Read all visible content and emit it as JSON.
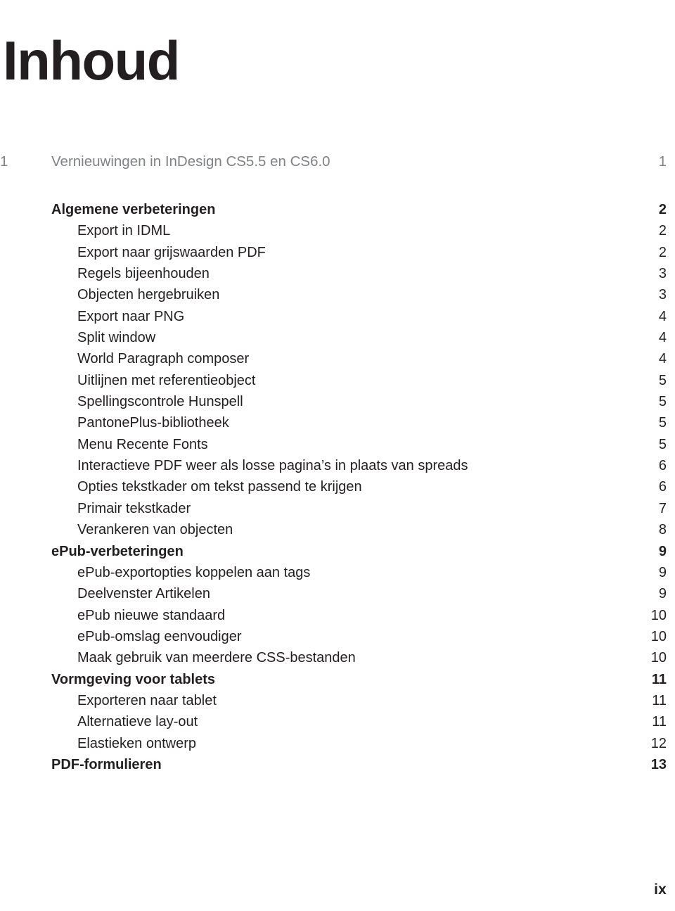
{
  "document": {
    "title": "Inhoud",
    "folio": "ix",
    "text_color": "#231f20",
    "chapter_color": "#808285",
    "background": "#ffffff"
  },
  "chapter": {
    "number": "1",
    "title": "Vernieuwingen in InDesign CS5.5 en CS6.0",
    "page": "1"
  },
  "entries": [
    {
      "level": 1,
      "label": "Algemene verbeteringen",
      "page": "2"
    },
    {
      "level": 2,
      "label": "Export in IDML",
      "page": "2"
    },
    {
      "level": 2,
      "label": "Export naar grijswaarden PDF",
      "page": "2"
    },
    {
      "level": 2,
      "label": "Regels bijeenhouden",
      "page": "3"
    },
    {
      "level": 2,
      "label": "Objecten hergebruiken",
      "page": "3"
    },
    {
      "level": 2,
      "label": "Export naar PNG",
      "page": "4"
    },
    {
      "level": 2,
      "label": "Split window",
      "page": "4"
    },
    {
      "level": 2,
      "label": "World Paragraph composer",
      "page": "4"
    },
    {
      "level": 2,
      "label": "Uitlijnen met referentieobject",
      "page": "5"
    },
    {
      "level": 2,
      "label": "Spellingscontrole Hunspell",
      "page": "5"
    },
    {
      "level": 2,
      "label": "PantonePlus-bibliotheek",
      "page": "5"
    },
    {
      "level": 2,
      "label": "Menu Recente Fonts",
      "page": "5"
    },
    {
      "level": 2,
      "label": "Interactieve PDF weer als losse pagina’s in plaats van spreads",
      "page": "6"
    },
    {
      "level": 2,
      "label": "Opties tekstkader om tekst passend te krijgen",
      "page": "6"
    },
    {
      "level": 2,
      "label": "Primair tekstkader",
      "page": "7"
    },
    {
      "level": 2,
      "label": "Verankeren van objecten",
      "page": "8"
    },
    {
      "level": 1,
      "label": "ePub-verbeteringen",
      "page": "9"
    },
    {
      "level": 2,
      "label": "ePub-exportopties koppelen aan tags",
      "page": "9"
    },
    {
      "level": 2,
      "label": "Deelvenster Artikelen",
      "page": "9"
    },
    {
      "level": 2,
      "label": "ePub nieuwe standaard",
      "page": "10"
    },
    {
      "level": 2,
      "label": "ePub-omslag eenvoudiger",
      "page": "10"
    },
    {
      "level": 2,
      "label": "Maak gebruik van meerdere CSS-bestanden",
      "page": "10"
    },
    {
      "level": 1,
      "label": "Vormgeving voor tablets",
      "page": "11"
    },
    {
      "level": 2,
      "label": "Exporteren naar tablet",
      "page": "11"
    },
    {
      "level": 2,
      "label": "Alternatieve lay-out",
      "page": "11"
    },
    {
      "level": 2,
      "label": "Elastieken ontwerp",
      "page": "12"
    },
    {
      "level": 1,
      "label": "PDF-formulieren",
      "page": "13"
    }
  ]
}
